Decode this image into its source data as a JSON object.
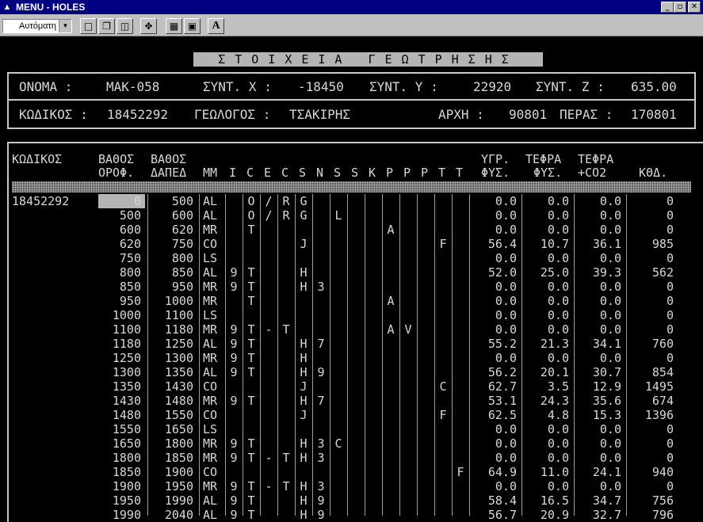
{
  "window": {
    "title": "MENU - HOLES",
    "icon": "app-icon",
    "minimize": "_",
    "maximize": "▫",
    "close": "✕"
  },
  "toolbar": {
    "font_select": "Αυτόματη",
    "buttons": [
      "mark-icon",
      "copy-icon",
      "paste-icon",
      "fullscreen-icon",
      "properties-icon",
      "background-icon",
      "font-icon"
    ],
    "font_label": "A"
  },
  "heading": "ΣΤΟΙΧΕΙΑ ΓΕΩΤΡΗΣΗΣ",
  "info": {
    "name_label": "ΟΝΟΜΑ :",
    "name_value": "MAK-058",
    "x_label": "ΣΥΝΤ. Χ :",
    "x_value": "-18450",
    "y_label": "ΣΥΝΤ. Υ :",
    "y_value": "22920",
    "z_label": "ΣΥΝΤ. Ζ :",
    "z_value": "635.00",
    "code_label": "ΚΩΔΙΚΟΣ :",
    "code_value": "18452292",
    "geo_label": "ΓΕΩΛΟΓΟΣ :",
    "geo_value": "ΤΣΑΚΙΡΗΣ",
    "start_label": "ΑΡΧΗ :",
    "start_value": "90801",
    "end_label": "ΠΕΡΑΣ :",
    "end_value": "170801"
  },
  "table": {
    "code_value": "18452292",
    "header_top": {
      "code": "ΚΩΔΙΚΟΣ",
      "from": "ΒΑΘΟΣ",
      "to": "ΒΑΘΟΣ",
      "moist": "ΥΓΡ.",
      "ash": "ΤΕΦΡΑ",
      "ashco2": "ΤΕΦΡΑ"
    },
    "header_bottom": {
      "from": "ΟΡΟΦ.",
      "to": "ΔΑΠΕΔ",
      "mm": "ΜΜ",
      "letters": [
        "I",
        "C",
        "E",
        "C",
        "S",
        "N",
        "S",
        "S",
        "K",
        "P",
        "P",
        "P",
        "T",
        "T"
      ],
      "moist": "ΦΥΣ.",
      "ash": "ΦΥΣ.",
      "ashco2": "+CO2",
      "kthd": "ΚΘΔ."
    },
    "rows": [
      {
        "from": "0",
        "to": "500",
        "mm": "AL",
        "f": [
          "",
          "O",
          "/",
          "R",
          "G",
          "",
          "",
          "",
          "",
          "",
          "",
          "",
          "",
          ""
        ],
        "moist": "0.0",
        "ash": "0.0",
        "ashco2": "0.0",
        "kthd": "0"
      },
      {
        "from": "500",
        "to": "600",
        "mm": "AL",
        "f": [
          "",
          "O",
          "/",
          "R",
          "G",
          "",
          "L",
          "",
          "",
          "",
          "",
          "",
          "",
          ""
        ],
        "moist": "0.0",
        "ash": "0.0",
        "ashco2": "0.0",
        "kthd": "0"
      },
      {
        "from": "600",
        "to": "620",
        "mm": "MR",
        "f": [
          "",
          "T",
          "",
          "",
          "",
          "",
          "",
          "",
          "",
          "A",
          "",
          "",
          "",
          ""
        ],
        "moist": "0.0",
        "ash": "0.0",
        "ashco2": "0.0",
        "kthd": "0"
      },
      {
        "from": "620",
        "to": "750",
        "mm": "CO",
        "f": [
          "",
          "",
          "",
          "",
          "J",
          "",
          "",
          "",
          "",
          "",
          "",
          "",
          "F",
          ""
        ],
        "moist": "56.4",
        "ash": "10.7",
        "ashco2": "36.1",
        "kthd": "985"
      },
      {
        "from": "750",
        "to": "800",
        "mm": "LS",
        "f": [
          "",
          "",
          "",
          "",
          "",
          "",
          "",
          "",
          "",
          "",
          "",
          "",
          "",
          ""
        ],
        "moist": "0.0",
        "ash": "0.0",
        "ashco2": "0.0",
        "kthd": "0"
      },
      {
        "from": "800",
        "to": "850",
        "mm": "AL",
        "f": [
          "9",
          "T",
          "",
          "",
          "H",
          "",
          "",
          "",
          "",
          "",
          "",
          "",
          "",
          ""
        ],
        "moist": "52.0",
        "ash": "25.0",
        "ashco2": "39.3",
        "kthd": "562"
      },
      {
        "from": "850",
        "to": "950",
        "mm": "MR",
        "f": [
          "9",
          "T",
          "",
          "",
          "H",
          "3",
          "",
          "",
          "",
          "",
          "",
          "",
          "",
          ""
        ],
        "moist": "0.0",
        "ash": "0.0",
        "ashco2": "0.0",
        "kthd": "0"
      },
      {
        "from": "950",
        "to": "1000",
        "mm": "MR",
        "f": [
          "",
          "T",
          "",
          "",
          "",
          "",
          "",
          "",
          "",
          "A",
          "",
          "",
          "",
          ""
        ],
        "moist": "0.0",
        "ash": "0.0",
        "ashco2": "0.0",
        "kthd": "0"
      },
      {
        "from": "1000",
        "to": "1100",
        "mm": "LS",
        "f": [
          "",
          "",
          "",
          "",
          "",
          "",
          "",
          "",
          "",
          "",
          "",
          "",
          "",
          ""
        ],
        "moist": "0.0",
        "ash": "0.0",
        "ashco2": "0.0",
        "kthd": "0"
      },
      {
        "from": "1100",
        "to": "1180",
        "mm": "MR",
        "f": [
          "9",
          "T",
          "-",
          "T",
          "",
          "",
          "",
          "",
          "",
          "A",
          "V",
          "",
          "",
          ""
        ],
        "moist": "0.0",
        "ash": "0.0",
        "ashco2": "0.0",
        "kthd": "0"
      },
      {
        "from": "1180",
        "to": "1250",
        "mm": "AL",
        "f": [
          "9",
          "T",
          "",
          "",
          "H",
          "7",
          "",
          "",
          "",
          "",
          "",
          "",
          "",
          ""
        ],
        "moist": "55.2",
        "ash": "21.3",
        "ashco2": "34.1",
        "kthd": "760"
      },
      {
        "from": "1250",
        "to": "1300",
        "mm": "MR",
        "f": [
          "9",
          "T",
          "",
          "",
          "H",
          "",
          "",
          "",
          "",
          "",
          "",
          "",
          "",
          ""
        ],
        "moist": "0.0",
        "ash": "0.0",
        "ashco2": "0.0",
        "kthd": "0"
      },
      {
        "from": "1300",
        "to": "1350",
        "mm": "AL",
        "f": [
          "9",
          "T",
          "",
          "",
          "H",
          "9",
          "",
          "",
          "",
          "",
          "",
          "",
          "",
          ""
        ],
        "moist": "56.2",
        "ash": "20.1",
        "ashco2": "30.7",
        "kthd": "854"
      },
      {
        "from": "1350",
        "to": "1430",
        "mm": "CO",
        "f": [
          "",
          "",
          "",
          "",
          "J",
          "",
          "",
          "",
          "",
          "",
          "",
          "",
          "C",
          ""
        ],
        "moist": "62.7",
        "ash": "3.5",
        "ashco2": "12.9",
        "kthd": "1495"
      },
      {
        "from": "1430",
        "to": "1480",
        "mm": "MR",
        "f": [
          "9",
          "T",
          "",
          "",
          "H",
          "7",
          "",
          "",
          "",
          "",
          "",
          "",
          "",
          ""
        ],
        "moist": "53.1",
        "ash": "24.3",
        "ashco2": "35.6",
        "kthd": "674"
      },
      {
        "from": "1480",
        "to": "1550",
        "mm": "CO",
        "f": [
          "",
          "",
          "",
          "",
          "J",
          "",
          "",
          "",
          "",
          "",
          "",
          "",
          "F",
          ""
        ],
        "moist": "62.5",
        "ash": "4.8",
        "ashco2": "15.3",
        "kthd": "1396"
      },
      {
        "from": "1550",
        "to": "1650",
        "mm": "LS",
        "f": [
          "",
          "",
          "",
          "",
          "",
          "",
          "",
          "",
          "",
          "",
          "",
          "",
          "",
          ""
        ],
        "moist": "0.0",
        "ash": "0.0",
        "ashco2": "0.0",
        "kthd": "0"
      },
      {
        "from": "1650",
        "to": "1800",
        "mm": "MR",
        "f": [
          "9",
          "T",
          "",
          "",
          "H",
          "3",
          "C",
          "",
          "",
          "",
          "",
          "",
          "",
          ""
        ],
        "moist": "0.0",
        "ash": "0.0",
        "ashco2": "0.0",
        "kthd": "0"
      },
      {
        "from": "1800",
        "to": "1850",
        "mm": "MR",
        "f": [
          "9",
          "T",
          "-",
          "T",
          "H",
          "3",
          "",
          "",
          "",
          "",
          "",
          "",
          "",
          ""
        ],
        "moist": "0.0",
        "ash": "0.0",
        "ashco2": "0.0",
        "kthd": "0"
      },
      {
        "from": "1850",
        "to": "1900",
        "mm": "CO",
        "f": [
          "",
          "",
          "",
          "",
          "",
          "",
          "",
          "",
          "",
          "",
          "",
          "",
          "",
          "F"
        ],
        "moist": "64.9",
        "ash": "11.0",
        "ashco2": "24.1",
        "kthd": "940"
      },
      {
        "from": "1900",
        "to": "1950",
        "mm": "MR",
        "f": [
          "9",
          "T",
          "-",
          "T",
          "H",
          "3",
          "",
          "",
          "",
          "",
          "",
          "",
          "",
          ""
        ],
        "moist": "0.0",
        "ash": "0.0",
        "ashco2": "0.0",
        "kthd": "0"
      },
      {
        "from": "1950",
        "to": "1990",
        "mm": "AL",
        "f": [
          "9",
          "T",
          "",
          "",
          "H",
          "9",
          "",
          "",
          "",
          "",
          "",
          "",
          "",
          ""
        ],
        "moist": "58.4",
        "ash": "16.5",
        "ashco2": "34.7",
        "kthd": "756"
      },
      {
        "from": "1990",
        "to": "2040",
        "mm": "AL",
        "f": [
          "9",
          "T",
          "",
          "",
          "H",
          "9",
          "",
          "",
          "",
          "",
          "",
          "",
          "",
          ""
        ],
        "moist": "56.7",
        "ash": "20.9",
        "ashco2": "32.7",
        "kthd": "796"
      }
    ]
  }
}
